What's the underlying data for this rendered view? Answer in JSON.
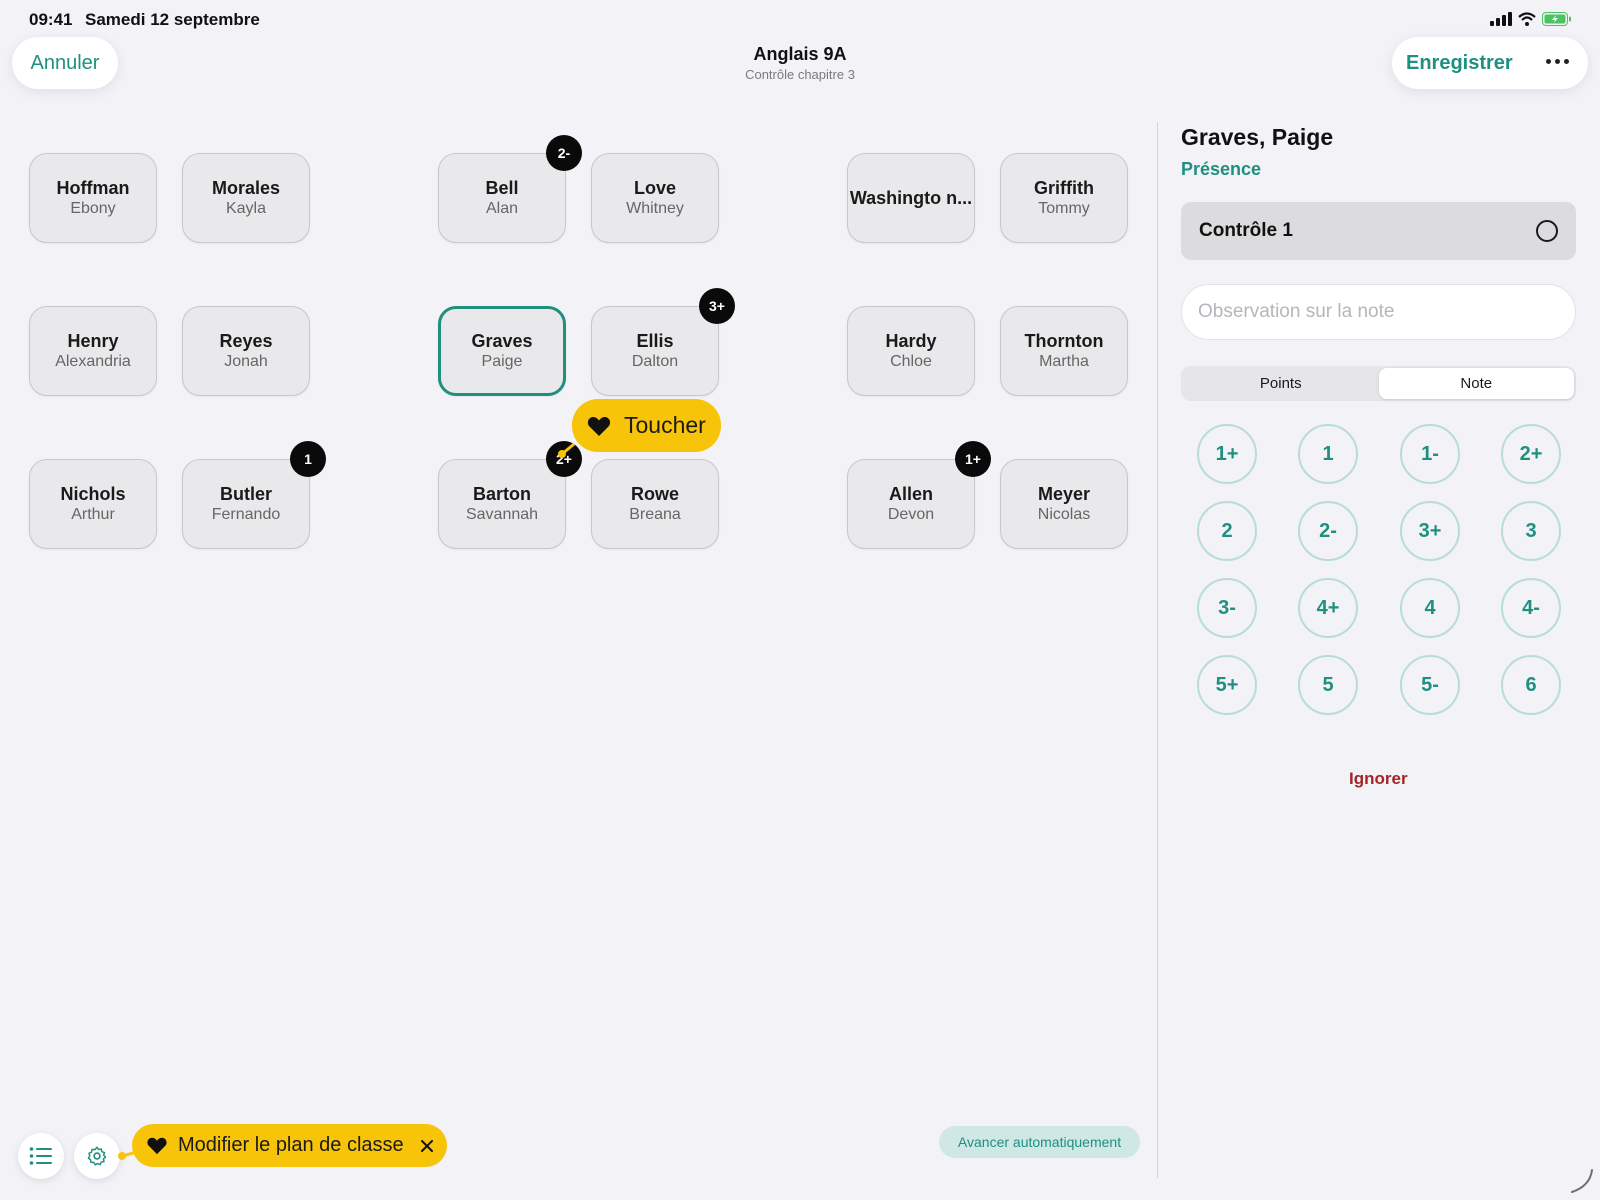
{
  "status_bar": {
    "time": "09:41",
    "date": "Samedi 12 septembre"
  },
  "header": {
    "cancel_label": "Annuler",
    "title": "Anglais 9A",
    "subtitle": "Contrôle chapitre 3",
    "save_label": "Enregistrer"
  },
  "students": [
    {
      "last": "Hoffman",
      "first": "Ebony",
      "badge": ""
    },
    {
      "last": "Morales",
      "first": "Kayla",
      "badge": ""
    },
    {
      "last": "Bell",
      "first": "Alan",
      "badge": "2-"
    },
    {
      "last": "Love",
      "first": "Whitney",
      "badge": ""
    },
    {
      "last": "Washingto n...",
      "first": "",
      "badge": ""
    },
    {
      "last": "Griffith",
      "first": "Tommy",
      "badge": ""
    },
    {
      "last": "Henry",
      "first": "Alexandria",
      "badge": ""
    },
    {
      "last": "Reyes",
      "first": "Jonah",
      "badge": ""
    },
    {
      "last": "Graves",
      "first": "Paige",
      "badge": ""
    },
    {
      "last": "Ellis",
      "first": "Dalton",
      "badge": "3+"
    },
    {
      "last": "Hardy",
      "first": "Chloe",
      "badge": ""
    },
    {
      "last": "Thornton",
      "first": "Martha",
      "badge": ""
    },
    {
      "last": "Nichols",
      "first": "Arthur",
      "badge": ""
    },
    {
      "last": "Butler",
      "first": "Fernando",
      "badge": "1"
    },
    {
      "last": "Barton",
      "first": "Savannah",
      "badge": "2+"
    },
    {
      "last": "Rowe",
      "first": "Breana",
      "badge": ""
    },
    {
      "last": "Allen",
      "first": "Devon",
      "badge": "1+"
    },
    {
      "last": "Meyer",
      "first": "Nicolas",
      "badge": ""
    }
  ],
  "touch_tip": {
    "label": "Toucher"
  },
  "panel": {
    "student_name": "Graves, Paige",
    "presence_label": "Présence",
    "control_label": "Contrôle 1",
    "observation_placeholder": "Observation sur la note",
    "segments": [
      "Points",
      "Note"
    ],
    "active_segment": "Note",
    "grades": [
      "1+",
      "1",
      "1-",
      "2+",
      "2",
      "2-",
      "3+",
      "3",
      "3-",
      "4+",
      "4",
      "4-",
      "5+",
      "5",
      "5-",
      "6"
    ],
    "ignore_label": "Ignorer"
  },
  "bottom": {
    "edit_plan_label": "Modifier le plan de classe",
    "auto_advance_label": "Avancer automatiquement"
  },
  "colors": {
    "accent": "#1f8f80",
    "tip": "#f8c409",
    "danger": "#a32626"
  }
}
